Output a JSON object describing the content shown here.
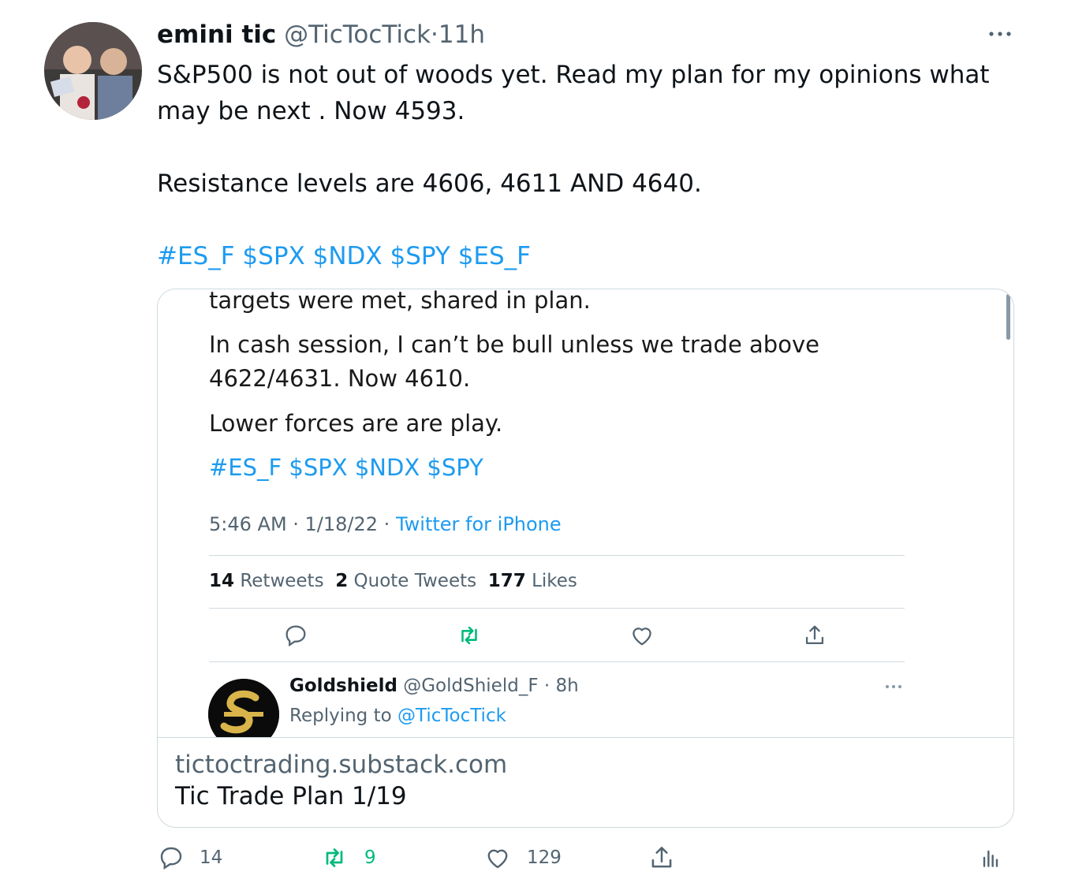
{
  "tweet": {
    "display_name": "emini tic",
    "handle": "@TicTocTick",
    "separator": "·",
    "time": "11h",
    "text_line1": "S&P500 is not out of woods yet. Read my plan for my opinions what",
    "text_line2": "may be next . Now 4593.",
    "text_line3": "Resistance levels are 4606, 4611 AND 4640.",
    "hashtags": "#ES_F $SPX $NDX $SPY $ES_F",
    "icons": {
      "avatar": "avatar-photo",
      "more": "more-horizontal-icon"
    }
  },
  "card": {
    "screenshot": {
      "line1": "targets were met, shared in plan.",
      "line2": "In cash session, I can’t be bull unless we trade above",
      "line3": "4622/4631. Now 4610.",
      "line4": "Lower forces are are play.",
      "hashtags": "#ES_F $SPX $NDX $SPY",
      "meta_time": "5:46 AM · 1/18/22 · ",
      "meta_source": "Twitter for iPhone",
      "retweets_count": "14",
      "retweets_label": "Retweets",
      "quotes_count": "2",
      "quotes_label": "Quote Tweets",
      "likes_count": "177",
      "likes_label": "Likes",
      "reply": {
        "name": "Goldshield",
        "handle_time": "@GoldShield_F · 8h",
        "replying_prefix": "Replying to ",
        "replying_handle": "@TicTocTick"
      }
    },
    "domain": "tictoctrading.substack.com",
    "title": "Tic Trade Plan 1/19"
  },
  "actions": {
    "reply_count": "14",
    "retweet_count": "9",
    "like_count": "129",
    "colors": {
      "retweet": "#00ba7c",
      "muted": "#536471",
      "link": "#1d9bf0"
    }
  }
}
